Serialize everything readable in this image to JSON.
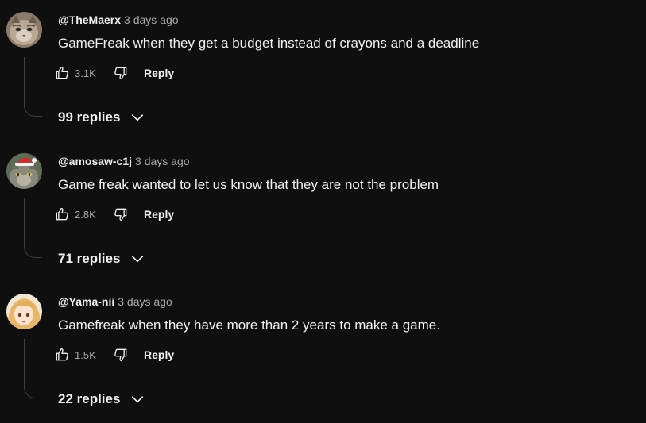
{
  "comments": [
    {
      "author": "@TheMaerx",
      "time": "3 days ago",
      "text": "GameFreak when they get a budget instead of crayons and a deadline",
      "likes": "3.1K",
      "reply_label": "Reply",
      "replies_label": "99 replies"
    },
    {
      "author": "@amosaw-c1j",
      "time": "3 days ago",
      "text": "Game freak wanted to let us know that they are not the problem",
      "likes": "2.8K",
      "reply_label": "Reply",
      "replies_label": "71 replies"
    },
    {
      "author": "@Yama-nii",
      "time": "3 days ago",
      "text": "Gamefreak when they have more than 2 years to make a game.",
      "likes": "1.5K",
      "reply_label": "Reply",
      "replies_label": "22 replies"
    }
  ],
  "icons": {
    "like": "thumbs-up-icon",
    "dislike": "thumbs-down-icon",
    "expand": "chevron-down-icon"
  },
  "colors": {
    "background": "#0f0f0f",
    "primary_text": "#f1f1f1",
    "secondary_text": "#aaaaaa",
    "thread_line": "#3f3f3f"
  }
}
